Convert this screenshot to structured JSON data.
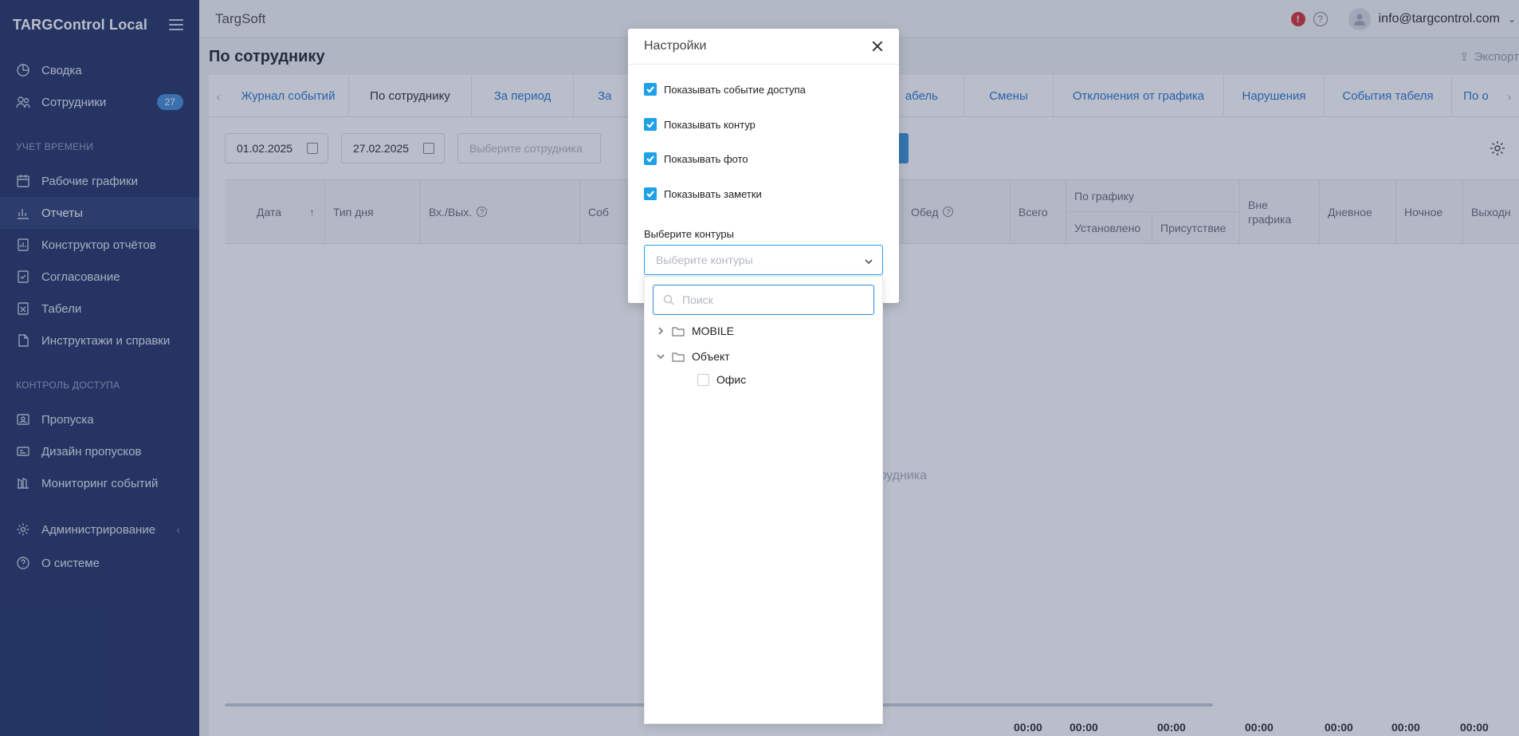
{
  "sidebar": {
    "brand": "TARGControl Local",
    "items": [
      {
        "label": "Сводка",
        "icon": "pie-chart-icon"
      },
      {
        "label": "Сотрудники",
        "icon": "users-icon",
        "badge": "27"
      }
    ],
    "section_time": "УЧЕТ ВРЕМЕНИ",
    "time_items": [
      {
        "label": "Рабочие графики",
        "icon": "calendar-icon"
      },
      {
        "label": "Отчеты",
        "icon": "bar-chart-icon",
        "active": true
      },
      {
        "label": "Конструктор отчётов",
        "icon": "report-builder-icon"
      },
      {
        "label": "Согласование",
        "icon": "checklist-icon"
      },
      {
        "label": "Табели",
        "icon": "timesheet-icon"
      },
      {
        "label": "Инструктажи и справки",
        "icon": "document-icon"
      }
    ],
    "section_access": "КОНТРОЛЬ ДОСТУПА",
    "access_items": [
      {
        "label": "Пропуска",
        "icon": "badge-icon"
      },
      {
        "label": "Дизайн пропусков",
        "icon": "design-icon"
      },
      {
        "label": "Мониторинг событий",
        "icon": "monitor-icon"
      }
    ],
    "bottom_items": [
      {
        "label": "Администрирование",
        "icon": "gear-icon"
      },
      {
        "label": "О системе",
        "icon": "help-icon"
      }
    ]
  },
  "topbar": {
    "company": "TargSoft",
    "alert": "!",
    "help": "?",
    "user_email": "info@targcontrol.com"
  },
  "page": {
    "title": "По сотруднику",
    "export_label": "Экспорт",
    "tabs": [
      "Журнал событий",
      "По сотруднику",
      "За период",
      "За",
      "абель",
      "Смены",
      "Отклонения от графика",
      "Нарушения",
      "События табеля",
      "По о"
    ],
    "date_from": "01.02.2025",
    "date_to": "27.02.2025",
    "employee_placeholder": "Выберите сотрудника",
    "columns": {
      "date": "Дата",
      "day_type": "Тип дня",
      "in_out": "Вх./Вых.",
      "events": "Соб",
      "lunch": "Обед",
      "total": "Всего",
      "by_schedule": "По графику",
      "set": "Установлено",
      "presence": "Присутствие",
      "off_schedule": "Вне графика",
      "day": "Дневное",
      "night": "Ночное",
      "weekend": "Выходн"
    },
    "empty_text": "и сотрудника",
    "totals": [
      "00:00",
      "00:00",
      "00:00",
      "00:00",
      "00:00",
      "00:00",
      "00:00"
    ]
  },
  "modal": {
    "title": "Настройки",
    "checkboxes": [
      {
        "label": "Показывать событие доступа",
        "checked": true
      },
      {
        "label": "Показывать контур",
        "checked": true
      },
      {
        "label": "Показывать фото",
        "checked": true
      },
      {
        "label": "Показывать заметки",
        "checked": true
      }
    ],
    "contours_label": "Выберите контуры",
    "contours_placeholder": "Выберите контуры",
    "search_placeholder": "Поиск",
    "tree": [
      {
        "label": "MOBILE",
        "expanded": false
      },
      {
        "label": "Объект",
        "expanded": true,
        "children": [
          {
            "label": "Офис",
            "checked": false
          }
        ]
      }
    ]
  },
  "colors": {
    "sidebar_bg": "#2a3a6a",
    "accent": "#1ea1e8",
    "link": "#2f7bd0",
    "alert": "#d8393f"
  }
}
